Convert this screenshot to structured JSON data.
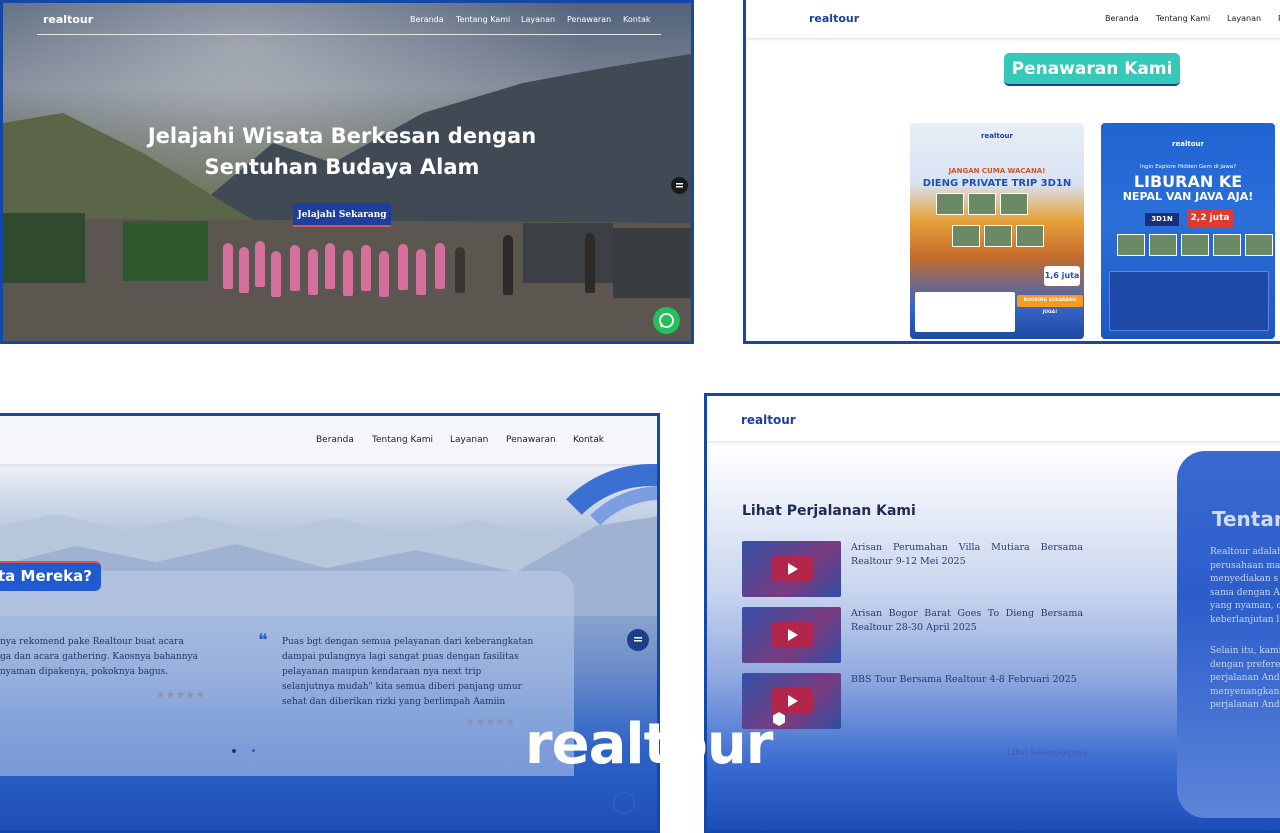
{
  "brand": {
    "name": "realtour",
    "dot_color": "#ffffff"
  },
  "colors": {
    "primary": "#1c3f9a",
    "accent_teal": "#34c9b8",
    "border_blue": "#1347a8",
    "whatsapp_green": "#25c05b"
  },
  "panel_hero": {
    "logo": "realtour",
    "nav": [
      "Beranda",
      "Tentang Kami",
      "Layanan",
      "Penawaran",
      "Kontak"
    ],
    "title_line1": "Jelajahi Wisata Berkesan dengan",
    "title_line2": "Sentuhan Budaya Alam",
    "cta": "Jelajahi Sekarang",
    "whatsapp_icon": "whatsapp-icon",
    "side_icon": "menu-bubble-icon"
  },
  "panel_offers": {
    "logo": "realtour",
    "nav": [
      "Beranda",
      "Tentang Kami",
      "Layanan",
      "P"
    ],
    "heading": "Penawaran Kami",
    "poster1": {
      "logo": "realtour",
      "tagline": "JANGAN CUMA WACANA!",
      "title": "DIENG PRIVATE TRIP 3D1N",
      "price": "1,6 juta",
      "booking": "BOOKING SEKARANG JUGA!"
    },
    "poster2": {
      "logo": "realtour",
      "tagline": "Ingin Explore Hidden Gem di Jawa?",
      "title_line1": "LIBURAN KE",
      "title_line2": "NEPAL VAN JAVA AJA!",
      "duration": "3D1N",
      "price": "2,2 juta"
    }
  },
  "panel_testimonials": {
    "nav": [
      "Beranda",
      "Tentang Kami",
      "Layanan",
      "Penawaran",
      "Kontak"
    ],
    "heading": "ta Mereka?",
    "quote1": [
      "nya rekomend pake Realtour buat acara",
      "ga dan acara gathering. Kaosnya bahannya",
      "nyaman dipakenya, pokoknya bagus."
    ],
    "quote2": [
      "Puas bgt dengan semua pelayanan dari keberangkatan",
      "dampai pulangnya lagi sangat puas dengan fasilitas",
      "pelayanan maupun kendaraan nya next trip",
      "selanjutnya mudah\" kita semua diberi panjang umur",
      "sehat dan diberikan rizki yang berlimpah Aamiin"
    ],
    "stars": "★★★★★",
    "quote_mark": "❝"
  },
  "panel_trips": {
    "logo": "realtour",
    "heading": "Lihat Perjalanan Kami",
    "videos": [
      {
        "title": "Arisan Perumahan Villa Mutiara Bersama Realtour 9-12 Mei 2025"
      },
      {
        "title": "Arisan Bogor Barat Goes To Dieng Bersama Realtour 28-30 April 2025"
      },
      {
        "title": "BBS Tour Bersama Realtour 4-8 Februari 2025"
      }
    ],
    "more": "Lihat Selengkapnya",
    "about_heading": "Tentan",
    "about_lines1": [
      "Realtour adalah",
      "perusahaan ma",
      "menyediakan s",
      "sama dengan A",
      "yang nyaman, d",
      "keberlanjutan l"
    ],
    "about_lines2": [
      "Selain itu, kami",
      "dengan prefere",
      "perjalanan And",
      "menyenangkan",
      "perjalanan And"
    ]
  }
}
